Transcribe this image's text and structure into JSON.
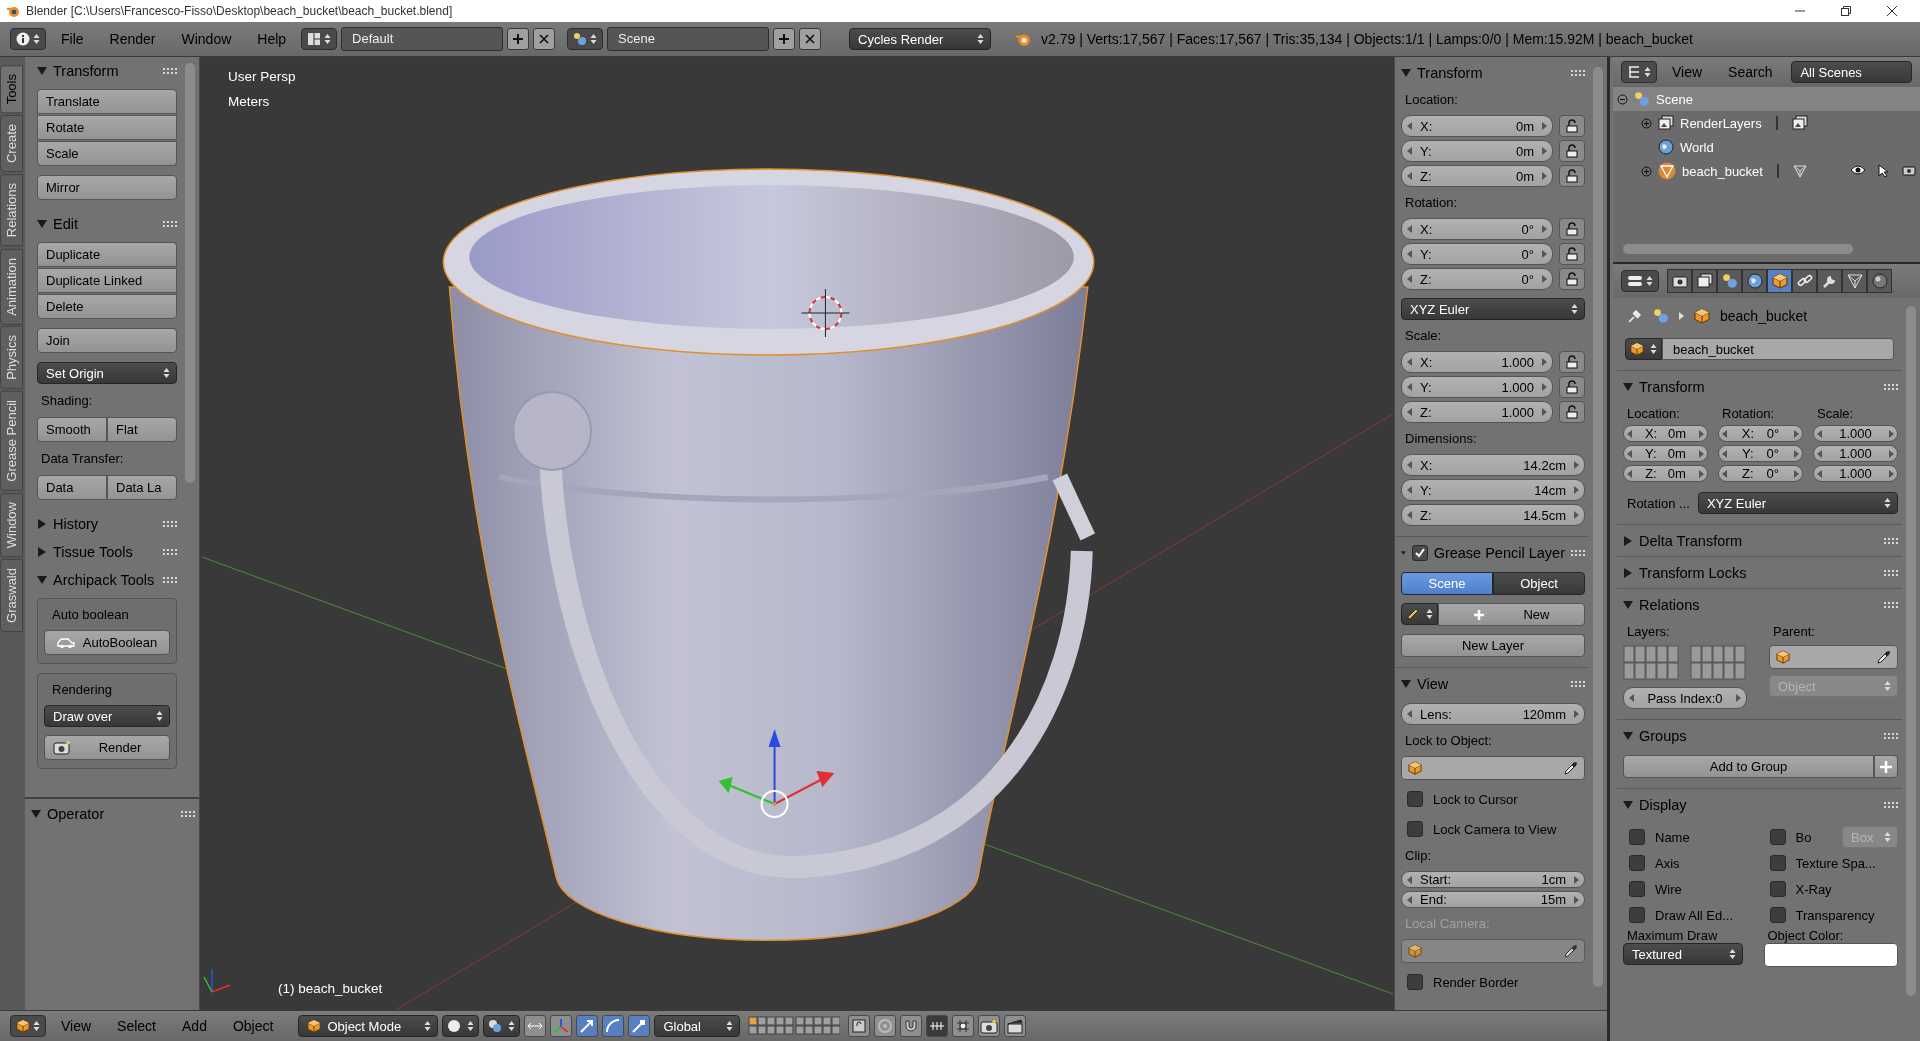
{
  "title_bar": {
    "title": "Blender [C:\\Users\\Francesco-Fisso\\Desktop\\beach_bucket\\beach_bucket.blend]"
  },
  "info_header": {
    "menus": [
      "File",
      "Render",
      "Window",
      "Help"
    ],
    "layout": "Default",
    "scene": "Scene",
    "engine": "Cycles Render",
    "stats": "v2.79 | Verts:17,567 | Faces:17,567 | Tris:35,134 | Objects:1/1 | Lamps:0/0 | Mem:15.92M | beach_bucket"
  },
  "tool_tabs": [
    {
      "label": "Tools",
      "selected": true
    },
    {
      "label": "Create",
      "selected": false
    },
    {
      "label": "Relations",
      "selected": false
    },
    {
      "label": "Animation",
      "selected": false
    },
    {
      "label": "Physics",
      "selected": false
    },
    {
      "label": "Grease Pencil",
      "selected": false
    },
    {
      "label": "Window",
      "selected": false
    },
    {
      "label": "Graswald",
      "selected": false
    }
  ],
  "tool_shelf": [
    {
      "title": "Transform",
      "expanded": true,
      "items": [
        {
          "kind": "column",
          "labels": [
            "Translate",
            "Rotate",
            "Scale"
          ]
        },
        {
          "kind": "column",
          "labels": [
            "Mirror"
          ]
        }
      ]
    },
    {
      "title": "Edit",
      "expanded": true,
      "items": [
        {
          "kind": "column",
          "labels": [
            "Duplicate",
            "Duplicate Linked",
            "Delete"
          ]
        },
        {
          "kind": "column",
          "labels": [
            "Join"
          ]
        },
        {
          "kind": "dropdown",
          "label": "Set Origin"
        },
        {
          "kind": "caption",
          "label": "Shading:"
        },
        {
          "kind": "row",
          "labels": [
            "Smooth",
            "Flat"
          ]
        },
        {
          "kind": "caption",
          "label": "Data Transfer:"
        },
        {
          "kind": "row",
          "labels": [
            "Data",
            "Data La"
          ]
        }
      ]
    },
    {
      "title": "History",
      "expanded": false
    },
    {
      "title": "Tissue Tools",
      "expanded": false
    },
    {
      "title": "Archipack Tools",
      "expanded": true,
      "items": [
        {
          "kind": "box",
          "items": [
            {
              "kind": "caption",
              "label": "Auto boolean"
            },
            {
              "kind": "boolbutton",
              "label": "AutoBoolean"
            }
          ]
        },
        {
          "kind": "box",
          "items": [
            {
              "kind": "caption",
              "label": "Rendering"
            },
            {
              "kind": "dropdown",
              "label": "Draw over"
            },
            {
              "kind": "renderbutton",
              "label": "Render"
            }
          ]
        }
      ]
    }
  ],
  "operator_panel": {
    "title": "Operator",
    "expanded": true
  },
  "viewport": {
    "view_name": "User Persp",
    "units": "Meters",
    "object_label": "(1) beach_bucket"
  },
  "n_panel": {
    "transform": {
      "title": "Transform",
      "expanded": true,
      "groups": [
        {
          "kind": "vector",
          "caption": "Location:",
          "fields": [
            {
              "label": "X:",
              "value": "0m",
              "locked": false
            },
            {
              "label": "Y:",
              "value": "0m",
              "locked": false
            },
            {
              "label": "Z:",
              "value": "0m",
              "locked": false
            }
          ]
        },
        {
          "kind": "vector",
          "caption": "Rotation:",
          "fields": [
            {
              "label": "X:",
              "value": "0°",
              "locked": false
            },
            {
              "label": "Y:",
              "value": "0°",
              "locked": false
            },
            {
              "label": "Z:",
              "value": "0°",
              "locked": false
            }
          ]
        },
        {
          "kind": "dropdown",
          "value": "XYZ Euler"
        },
        {
          "kind": "vector",
          "caption": "Scale:",
          "fields": [
            {
              "label": "X:",
              "value": "1.000",
              "locked": false
            },
            {
              "label": "Y:",
              "value": "1.000",
              "locked": false
            },
            {
              "label": "Z:",
              "value": "1.000",
              "locked": false
            }
          ]
        },
        {
          "kind": "vector",
          "caption": "Dimensions:",
          "fields": [
            {
              "label": "X:",
              "value": "14.2cm"
            },
            {
              "label": "Y:",
              "value": "14cm"
            },
            {
              "label": "Z:",
              "value": "14.5cm"
            }
          ]
        }
      ]
    },
    "grease_pencil": {
      "title": "Grease Pencil Layer",
      "expanded": true,
      "checked": true,
      "tabs": [
        {
          "label": "Scene",
          "selected": true
        },
        {
          "label": "Object",
          "selected": false
        }
      ],
      "new_button": "New",
      "new_layer_button": "New Layer"
    },
    "view": {
      "title": "View",
      "expanded": true,
      "lens_label": "Lens:",
      "lens": "120mm",
      "lock_object_caption": "Lock to Object:",
      "checks": [
        {
          "label": "Lock to Cursor",
          "checked": false
        },
        {
          "label": "Lock Camera to View",
          "checked": false
        }
      ],
      "clip_caption": "Clip:",
      "clip": [
        {
          "label": "Start:",
          "value": "1cm"
        },
        {
          "label": "End:",
          "value": "15m"
        }
      ],
      "local_camera_caption": "Local Camera:",
      "local_camera_disabled": true,
      "render_border": {
        "label": "Render Border",
        "checked": false
      }
    }
  },
  "outliner": {
    "menus": [
      "View",
      "Search"
    ],
    "filter": "All Scenes",
    "tree": [
      {
        "kind": "scene",
        "label": "Scene",
        "selected": true,
        "expanded": true,
        "children": [
          {
            "kind": "renderlayers",
            "label": "RenderLayers",
            "selected": false,
            "expanded": false
          },
          {
            "kind": "world",
            "label": "World",
            "selected": false
          },
          {
            "kind": "mesh",
            "label": "beach_bucket",
            "selected": false,
            "expanded": false
          }
        ]
      }
    ]
  },
  "properties": {
    "tabs": [
      {
        "kind": "render",
        "selected": false
      },
      {
        "kind": "layers",
        "selected": false
      },
      {
        "kind": "scene",
        "selected": false
      },
      {
        "kind": "world",
        "selected": false
      },
      {
        "kind": "object",
        "selected": true
      },
      {
        "kind": "constraints",
        "selected": false
      },
      {
        "kind": "modifiers",
        "selected": false
      },
      {
        "kind": "data",
        "selected": false
      },
      {
        "kind": "material",
        "selected": false
      }
    ],
    "breadcrumb": "beach_bucket",
    "object_name": "beach_bucket",
    "panels": [
      {
        "kind": "transform",
        "title": "Transform",
        "expanded": true,
        "columns": [
          {
            "caption": "Location:",
            "fields": [
              {
                "label": "X:",
                "value": "0m"
              },
              {
                "label": "Y:",
                "value": "0m"
              },
              {
                "label": "Z:",
                "value": "0m"
              }
            ]
          },
          {
            "caption": "Rotation:",
            "fields": [
              {
                "label": "X:",
                "value": "0°"
              },
              {
                "label": "Y:",
                "value": "0°"
              },
              {
                "label": "Z:",
                "value": "0°"
              }
            ]
          },
          {
            "caption": "Scale:",
            "fields": [
              {
                "value": "1.000"
              },
              {
                "value": "1.000"
              },
              {
                "value": "1.000"
              }
            ]
          }
        ],
        "rotation_label": "Rotation ...",
        "rotation_mode": "XYZ Euler"
      },
      {
        "title": "Delta Transform",
        "expanded": false
      },
      {
        "title": "Transform Locks",
        "expanded": false
      },
      {
        "kind": "relations",
        "title": "Relations",
        "expanded": true,
        "layers_caption": "Layers:",
        "parent_caption": "Parent:",
        "parent_type": "Object",
        "parent_type_disabled": true,
        "pass_index": "Pass Index:0"
      },
      {
        "kind": "groups",
        "title": "Groups",
        "expanded": true,
        "add_button": "Add to Group"
      },
      {
        "kind": "display",
        "title": "Display",
        "expanded": true,
        "checks": [
          {
            "label": "Name",
            "checked": false
          },
          {
            "label": "Bo",
            "checked": false
          },
          {
            "label": "Axis",
            "checked": false
          },
          {
            "label": "Texture Spa...",
            "checked": false
          },
          {
            "label": "Wire",
            "checked": false
          },
          {
            "label": "X-Ray",
            "checked": false
          },
          {
            "label": "Draw All Ed...",
            "checked": false
          },
          {
            "label": "Transparency",
            "checked": false
          }
        ],
        "bounds_type": "Box",
        "bounds_disabled": true,
        "max_draw_caption": "Maximum Draw",
        "color_caption": "Object Color:",
        "max_draw": "Textured"
      }
    ]
  },
  "view3d_header": {
    "menus": [
      "View",
      "Select",
      "Add",
      "Object"
    ],
    "mode": "Object Mode",
    "orientation": "Global"
  }
}
